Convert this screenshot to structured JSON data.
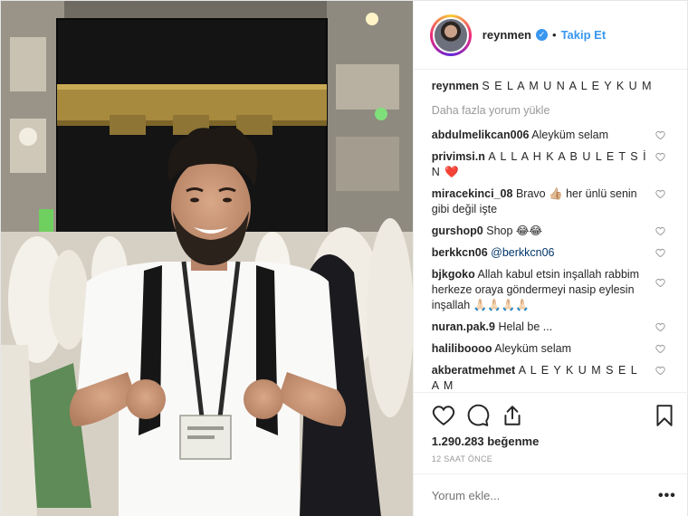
{
  "header": {
    "username": "reynmen",
    "separator": "•",
    "follow_label": "Takip Et"
  },
  "caption": {
    "username": "reynmen",
    "text": "S E L A M U N A L E Y K U M"
  },
  "load_more_label": "Daha fazla yorum yükle",
  "comments": [
    {
      "username": "abdulmelikcan006",
      "text": "Aleyküm selam"
    },
    {
      "username": "privimsi.n",
      "text": "A L L A H K A B U L E T S İ N ❤️"
    },
    {
      "username": "miracekinci_08",
      "text": "Bravo 👍🏼 her ünlü senin gibi değil işte"
    },
    {
      "username": "gurshop0",
      "text": "Shop 😂😂"
    },
    {
      "username": "berkkcn06",
      "text": "@berkkcn06"
    },
    {
      "username": "bjkgoko",
      "text": "Allah kabul etsin inşallah rabbim herkeze oraya göndermeyi nasip eylesin inşallah 🙏🏻🙏🏻🙏🏻🙏🏻"
    },
    {
      "username": "nuran.pak.9",
      "text": "Helal be ..."
    },
    {
      "username": "haliliboooo",
      "text": "Aleyküm selam"
    },
    {
      "username": "akberatmehmet",
      "text": "A L E Y K U M S E L A M"
    }
  ],
  "likes": "1.290.283 beğenme",
  "timestamp": "12 SAAT ÖNCE",
  "add_comment": {
    "placeholder": "Yorum ekle..."
  },
  "more_options": "•••",
  "colors": {
    "accent": "#3897f0",
    "muted": "#999999",
    "text": "#262626"
  }
}
